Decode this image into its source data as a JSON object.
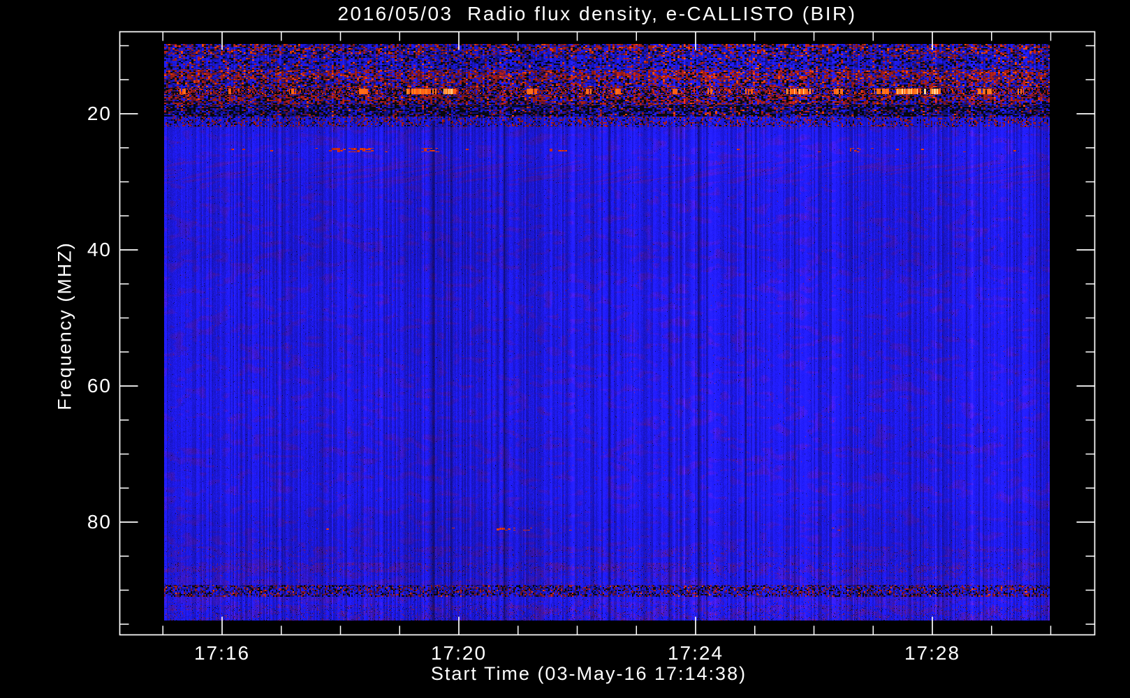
{
  "chart_data": {
    "type": "heatmap",
    "title": "2016/05/03  Radio flux density, e-CALLISTO (BIR)",
    "xlabel": "Start Time (03-May-16 17:14:38)",
    "ylabel": "Frequency (MHZ)",
    "grid": false,
    "legend": false,
    "y_axis_inverted": true,
    "y_axis_range_mhz": [
      7.9,
      96.6
    ],
    "image_freq_range_mhz": [
      9.74,
      94.4
    ],
    "x_axis_range_time": [
      "17:14:16",
      "17:30:45"
    ],
    "image_time_range": [
      "17:15:00",
      "17:30:00"
    ],
    "y_ticks": [
      {
        "label": "20",
        "mhz": 20
      },
      {
        "label": "40",
        "mhz": 40
      },
      {
        "label": "60",
        "mhz": 60
      },
      {
        "label": "80",
        "mhz": 80
      }
    ],
    "y_minor_ticks_mhz": [
      10,
      15,
      25,
      30,
      35,
      45,
      50,
      55,
      65,
      70,
      75,
      85,
      90,
      95
    ],
    "x_ticks": [
      {
        "label": "17:16",
        "minute": 16
      },
      {
        "label": "17:20",
        "minute": 20
      },
      {
        "label": "17:24",
        "minute": 24
      },
      {
        "label": "17:28",
        "minute": 28
      }
    ],
    "x_minor_ticks_min": [
      15,
      17,
      18,
      19,
      21,
      22,
      23,
      25,
      26,
      27,
      29,
      30
    ],
    "palette": {
      "blue": [
        30,
        26,
        234
      ],
      "blue_dark": [
        20,
        18,
        140
      ],
      "black": [
        8,
        8,
        16
      ],
      "red": [
        168,
        30,
        24
      ],
      "red_bright": [
        255,
        70,
        8
      ],
      "orange": [
        255,
        150,
        40
      ],
      "white_hot": [
        255,
        214,
        150
      ],
      "purple": [
        108,
        20,
        138
      ],
      "maroon": [
        98,
        18,
        62
      ]
    },
    "bands": [
      {
        "f0": 9.0,
        "f1": 11.2,
        "style": "mix"
      },
      {
        "f0": 11.2,
        "f1": 13.5,
        "style": "blue_dark_mix"
      },
      {
        "f0": 13.5,
        "f1": 14.8,
        "style": "red_mix"
      },
      {
        "f0": 14.8,
        "f1": 16.1,
        "style": "mix2"
      },
      {
        "f0": 16.1,
        "f1": 17.2,
        "style": "burst"
      },
      {
        "f0": 17.2,
        "f1": 18.6,
        "style": "red_dark"
      },
      {
        "f0": 18.6,
        "f1": 20.3,
        "style": "dark"
      },
      {
        "f0": 20.3,
        "f1": 21.9,
        "style": "blue_red"
      },
      {
        "f0": 21.9,
        "f1": 24.6,
        "style": "body"
      },
      {
        "f0": 24.6,
        "f1": 25.9,
        "style": "dotline"
      },
      {
        "f0": 25.9,
        "f1": 26.8,
        "style": "body"
      },
      {
        "f0": 26.8,
        "f1": 30.2,
        "style": "wisps"
      },
      {
        "f0": 30.2,
        "f1": 80.4,
        "style": "body"
      },
      {
        "f0": 80.4,
        "f1": 81.4,
        "style": "dotrow"
      },
      {
        "f0": 81.4,
        "f1": 83.5,
        "style": "body"
      },
      {
        "f0": 83.5,
        "f1": 85.0,
        "style": "purple_soft"
      },
      {
        "f0": 85.0,
        "f1": 85.8,
        "style": "body"
      },
      {
        "f0": 85.8,
        "f1": 87.3,
        "style": "purple"
      },
      {
        "f0": 87.3,
        "f1": 89.1,
        "style": "purple_soft"
      },
      {
        "f0": 89.1,
        "f1": 90.9,
        "style": "speckle_dark"
      },
      {
        "f0": 90.9,
        "f1": 92.1,
        "style": "purple_soft"
      },
      {
        "f0": 92.1,
        "f1": 95.0,
        "style": "bottom"
      }
    ],
    "styles": {
      "mix": {
        "kind": "weighted",
        "chunk": [
          3,
          2
        ],
        "weights": [
          [
            "blue",
            0.33
          ],
          [
            "red",
            0.21
          ],
          [
            "blue_dark",
            0.16
          ],
          [
            "black",
            0.17
          ],
          [
            "maroon",
            0.07
          ],
          [
            "red_bright",
            0.06
          ]
        ]
      },
      "blue_dark_mix": {
        "kind": "weighted",
        "chunk": [
          3,
          2
        ],
        "weights": [
          [
            "blue",
            0.5
          ],
          [
            "blue_dark",
            0.19
          ],
          [
            "black",
            0.15
          ],
          [
            "red",
            0.1
          ],
          [
            "maroon",
            0.04
          ],
          [
            "red_bright",
            0.02
          ]
        ]
      },
      "red_mix": {
        "kind": "weighted",
        "chunk": [
          3,
          2
        ],
        "weights": [
          [
            "red",
            0.32
          ],
          [
            "blue",
            0.26
          ],
          [
            "maroon",
            0.15
          ],
          [
            "black",
            0.1
          ],
          [
            "blue_dark",
            0.09
          ],
          [
            "red_bright",
            0.08
          ]
        ]
      },
      "mix2": {
        "kind": "weighted",
        "chunk": [
          3,
          2
        ],
        "weights": [
          [
            "blue",
            0.3
          ],
          [
            "red",
            0.24
          ],
          [
            "black",
            0.18
          ],
          [
            "blue_dark",
            0.14
          ],
          [
            "maroon",
            0.1
          ],
          [
            "red_bright",
            0.04
          ]
        ]
      },
      "burst": {
        "kind": "weighted",
        "chunk": [
          2,
          2
        ],
        "bursts": true,
        "weights": [
          [
            "black",
            0.3
          ],
          [
            "red",
            0.26
          ],
          [
            "blue",
            0.16
          ],
          [
            "maroon",
            0.16
          ],
          [
            "blue_dark",
            0.08
          ],
          [
            "red_bright",
            0.04
          ]
        ]
      },
      "red_dark": {
        "kind": "weighted",
        "chunk": [
          3,
          2
        ],
        "weights": [
          [
            "red",
            0.3
          ],
          [
            "black",
            0.26
          ],
          [
            "blue",
            0.2
          ],
          [
            "maroon",
            0.12
          ],
          [
            "blue_dark",
            0.1
          ],
          [
            "red_bright",
            0.02
          ]
        ]
      },
      "dark": {
        "kind": "weighted",
        "chunk": [
          3,
          2
        ],
        "weights": [
          [
            "black",
            0.42
          ],
          [
            "blue_dark",
            0.28
          ],
          [
            "blue",
            0.15
          ],
          [
            "maroon",
            0.08
          ],
          [
            "red",
            0.06
          ],
          [
            "red_bright",
            0.01
          ]
        ]
      },
      "blue_red": {
        "kind": "weighted",
        "chunk": [
          2,
          2
        ],
        "weights": [
          [
            "blue",
            0.62
          ],
          [
            "red",
            0.13
          ],
          [
            "blue_dark",
            0.12
          ],
          [
            "black",
            0.07
          ],
          [
            "maroon",
            0.06
          ]
        ]
      },
      "speckle_dark": {
        "kind": "weighted",
        "chunk": [
          2,
          2
        ],
        "weights": [
          [
            "blue",
            0.4
          ],
          [
            "blue_dark",
            0.2
          ],
          [
            "black",
            0.15
          ],
          [
            "maroon",
            0.16
          ],
          [
            "red",
            0.08
          ],
          [
            "red_bright",
            0.01
          ]
        ]
      },
      "body": {
        "kind": "mottle",
        "thr": 0.62,
        "blend": 0.42,
        "spec_red": 0.002,
        "spec_dark": 0.004
      },
      "dotline": {
        "kind": "mottle",
        "thr": 0.62,
        "blend": 0.38,
        "spec_red": 0.002,
        "spec_dark": 0.004,
        "dots": "dash_segments_25mhz",
        "dot_p": 0.38,
        "dot_bg_p": 0.012
      },
      "wisps": {
        "kind": "mottle",
        "thr": 0.55,
        "blend": 0.5,
        "spec_red": 0.003,
        "spec_dark": 0.004,
        "diag": 5
      },
      "dotrow": {
        "kind": "mottle",
        "thr": 0.62,
        "blend": 0.4,
        "spec_red": 0.004,
        "spec_dark": 0.004,
        "dots": "dash_segments_81mhz",
        "dot_p": 0.45,
        "dot_bg_p": 0.006
      },
      "purple_soft": {
        "kind": "mottle",
        "thr": 0.52,
        "blend": 0.45,
        "spec_red": 0.02,
        "spec_dark": 0.015
      },
      "purple": {
        "kind": "mottle",
        "thr": 0.44,
        "blend": 0.55,
        "spec_red": 0.05,
        "spec_dark": 0.03
      },
      "bottom": {
        "kind": "mottle",
        "thr": 0.5,
        "blend": 0.5,
        "spec_red": 0.06,
        "spec_dark": 0.04
      }
    },
    "features": {
      "burst_segments": [
        [
          0.02,
          0.008,
          0.5
        ],
        [
          0.075,
          0.006,
          0.45
        ],
        [
          0.145,
          0.008,
          0.5
        ],
        [
          0.225,
          0.01,
          0.6
        ],
        [
          0.29,
          0.034,
          0.85
        ],
        [
          0.322,
          0.014,
          0.92
        ],
        [
          0.415,
          0.012,
          0.65
        ],
        [
          0.478,
          0.009,
          0.6
        ],
        [
          0.512,
          0.007,
          0.55
        ],
        [
          0.575,
          0.009,
          0.65
        ],
        [
          0.615,
          0.007,
          0.55
        ],
        [
          0.66,
          0.009,
          0.6
        ],
        [
          0.716,
          0.028,
          0.92
        ],
        [
          0.762,
          0.012,
          0.8
        ],
        [
          0.81,
          0.016,
          0.85
        ],
        [
          0.843,
          0.034,
          0.95
        ],
        [
          0.872,
          0.014,
          0.92
        ],
        [
          0.926,
          0.016,
          0.8
        ],
        [
          0.966,
          0.009,
          0.6
        ]
      ],
      "dash_segments_25mhz": [
        [
          0.215,
          0.055
        ],
        [
          0.3,
          0.02
        ],
        [
          0.445,
          0.02
        ],
        [
          0.78,
          0.012
        ]
      ],
      "dash_segments_81mhz": [
        [
          0.385,
          0.022
        ],
        [
          0.41,
          0.01
        ]
      ],
      "dark_columns": [
        [
          0.282,
          2,
          0.3
        ],
        [
          0.304,
          3,
          0.42
        ],
        [
          0.323,
          2,
          0.28
        ],
        [
          0.384,
          3,
          0.5
        ],
        [
          0.502,
          2,
          0.38
        ],
        [
          0.57,
          3,
          0.42
        ],
        [
          0.583,
          2,
          0.3
        ],
        [
          0.603,
          3,
          0.42
        ],
        [
          0.613,
          2,
          0.35
        ],
        [
          0.64,
          3,
          0.32
        ],
        [
          0.656,
          3,
          0.42
        ],
        [
          0.668,
          2,
          0.32
        ],
        [
          0.711,
          2,
          0.28
        ],
        [
          0.99,
          2,
          0.3
        ]
      ]
    }
  }
}
